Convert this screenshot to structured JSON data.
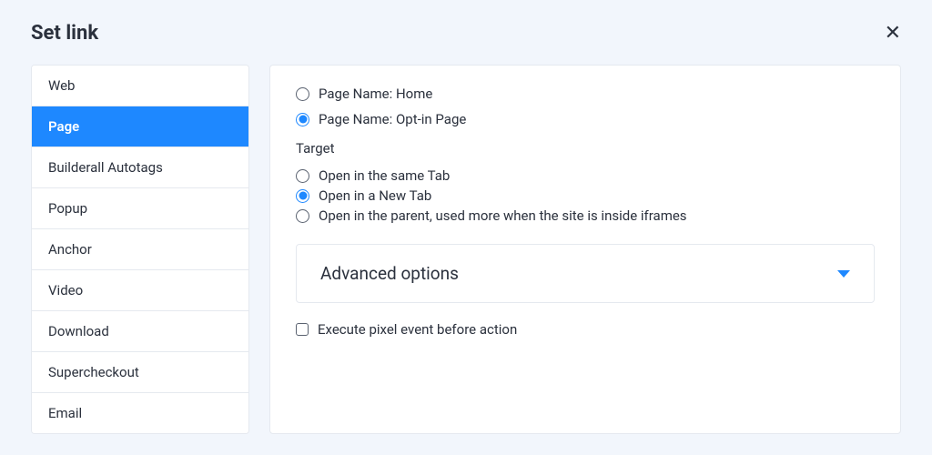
{
  "dialog": {
    "title": "Set link"
  },
  "sidebar": {
    "items": [
      {
        "label": "Web",
        "active": false
      },
      {
        "label": "Page",
        "active": true
      },
      {
        "label": "Builderall Autotags",
        "active": false
      },
      {
        "label": "Popup",
        "active": false
      },
      {
        "label": "Anchor",
        "active": false
      },
      {
        "label": "Video",
        "active": false
      },
      {
        "label": "Download",
        "active": false
      },
      {
        "label": "Supercheckout",
        "active": false
      },
      {
        "label": "Email",
        "active": false
      }
    ]
  },
  "panel": {
    "page_options": [
      {
        "label": "Page Name: Home",
        "checked": false
      },
      {
        "label": "Page Name: Opt-in Page",
        "checked": true
      }
    ],
    "target_label": "Target",
    "target_options": [
      {
        "label": "Open in the same Tab",
        "checked": false
      },
      {
        "label": "Open in a New Tab",
        "checked": true
      },
      {
        "label": "Open in the parent, used more when the site is inside iframes",
        "checked": false
      }
    ],
    "advanced_label": "Advanced options",
    "pixel_label": "Execute pixel event before action",
    "pixel_checked": false
  }
}
